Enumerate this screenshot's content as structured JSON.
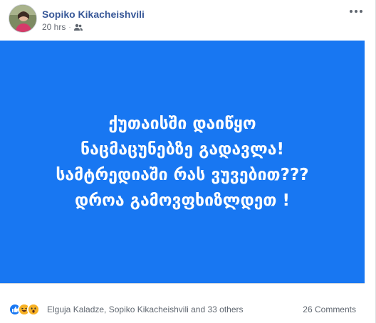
{
  "post": {
    "author": "Sopiko Kikacheishvili",
    "time": "20 hrs",
    "separator": "·",
    "privacy_icon": "friends-icon",
    "more_icon": "more-options-icon"
  },
  "banner": {
    "background": "#1877f2",
    "lines": [
      "ქუთაისში დაიწყო",
      "ნაცმაცუნებზე გადავლა!",
      "სამტრედიაში რას ვუვებით???",
      "დროა გამოვფხიზლდეთ !"
    ]
  },
  "footer": {
    "reaction_icons": [
      "like-icon",
      "haha-icon",
      "wow-icon"
    ],
    "reactors": "Elguja Kaladze, Sopiko Kikacheishvili and 33 others",
    "comments": "26 Comments"
  },
  "colors": {
    "author_link": "#385898",
    "banner": "#1877f2",
    "meta_text": "#616770"
  }
}
